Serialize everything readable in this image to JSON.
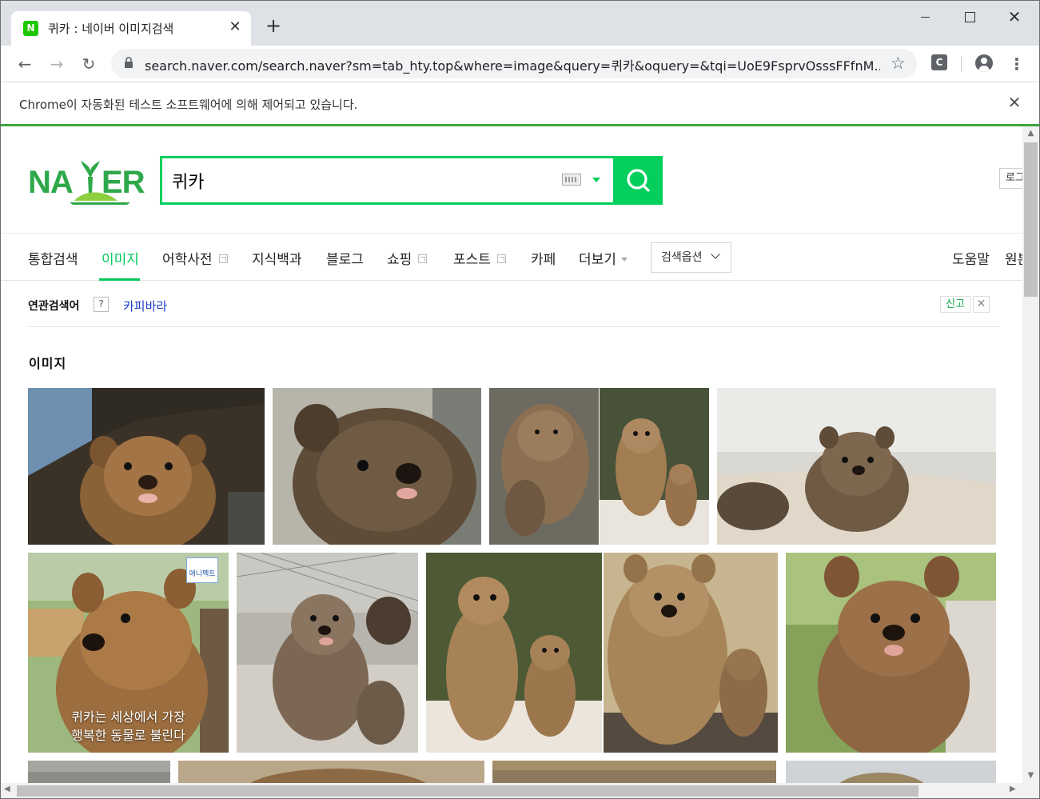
{
  "browser": {
    "tab_title": "퀴카 : 네이버 이미지검색",
    "favicon_letter": "N",
    "url": "search.naver.com/search.naver?sm=tab_hty.top&where=image&query=퀴카&oquery=&tqi=UoE9FsprvOsssFFfnM...",
    "extension_letter": "C",
    "infobar_text": "Chrome이 자동화된 테스트 소프트웨어에 의해 제어되고 있습니다."
  },
  "search": {
    "query": "퀴카",
    "login_label": "로그"
  },
  "nav": {
    "items": [
      {
        "label": "통합검색",
        "active": false,
        "newwin": false
      },
      {
        "label": "이미지",
        "active": true,
        "newwin": false
      },
      {
        "label": "어학사전",
        "active": false,
        "newwin": true
      },
      {
        "label": "지식백과",
        "active": false,
        "newwin": false
      },
      {
        "label": "블로그",
        "active": false,
        "newwin": false
      },
      {
        "label": "쇼핑",
        "active": false,
        "newwin": true
      },
      {
        "label": "포스트",
        "active": false,
        "newwin": true
      },
      {
        "label": "카페",
        "active": false,
        "newwin": false
      },
      {
        "label": "더보기",
        "active": false,
        "newwin": false
      }
    ],
    "options_label": "검색옵션",
    "help_label": "도움말",
    "right_cut_label": "원본"
  },
  "related": {
    "title": "연관검색어",
    "help_mark": "?",
    "keyword": "카피바라",
    "report_label": "신고"
  },
  "section": {
    "title": "이미지"
  },
  "images": [
    {
      "name": "quokka-image-1"
    },
    {
      "name": "quokka-image-2"
    },
    {
      "name": "quokka-image-3"
    },
    {
      "name": "quokka-image-4"
    },
    {
      "name": "quokka-image-5",
      "caption_line1": "퀴카는 세상에서 가장",
      "caption_line2": "행복한 동물로 불린다",
      "badge": "애니펙트"
    },
    {
      "name": "quokka-image-6"
    },
    {
      "name": "quokka-image-7"
    },
    {
      "name": "quokka-image-8"
    },
    {
      "name": "quokka-image-9"
    }
  ],
  "colors": {
    "naver_green": "#03cf5d",
    "active_tab": "#03c75a",
    "related_link": "#1a3ccb"
  }
}
